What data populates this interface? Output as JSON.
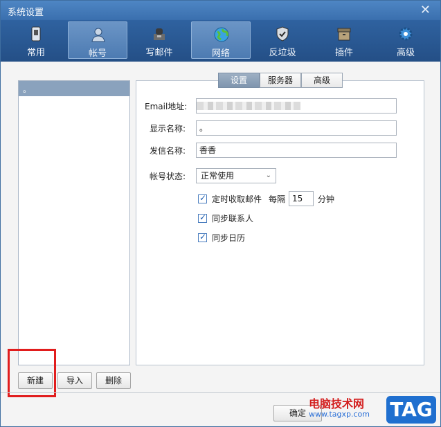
{
  "window": {
    "title": "系统设置",
    "close": "✕"
  },
  "toolbar": {
    "items": [
      {
        "label": "常用",
        "icon": "phone-icon"
      },
      {
        "label": "帐号",
        "icon": "user-icon",
        "active": true
      },
      {
        "label": "写邮件",
        "icon": "write-mail-icon"
      },
      {
        "label": "网络",
        "icon": "globe-icon",
        "highlighted": true
      },
      {
        "label": "反垃圾",
        "icon": "shield-icon"
      },
      {
        "label": "插件",
        "icon": "plugin-icon"
      },
      {
        "label": "高级",
        "icon": "gear-icon"
      }
    ]
  },
  "accounts": {
    "selected": "。"
  },
  "left_buttons": {
    "new": "新建",
    "import": "导入",
    "delete": "删除"
  },
  "tabs": {
    "settings": "设置",
    "server": "服务器",
    "advanced": "高级"
  },
  "form": {
    "email_label": "Email地址:",
    "display_label": "显示名称:",
    "display_value": "。",
    "sender_label": "发信名称:",
    "sender_value": "香香",
    "status_label": "帐号状态:",
    "status_value": "正常使用",
    "timed_receive": "定时收取邮件",
    "every": "每隔",
    "interval": "15",
    "minutes": "分钟",
    "sync_contacts": "同步联系人",
    "sync_calendar": "同步日历"
  },
  "footer": {
    "ok": "确定"
  },
  "watermark": {
    "line1": "电脑技术网",
    "line2": "www.tagxp.com",
    "badge": "TAG"
  },
  "colors": {
    "toolbar": "#2f62a0",
    "highlight": "#e11d1d",
    "accent": "#1f6fcf"
  }
}
